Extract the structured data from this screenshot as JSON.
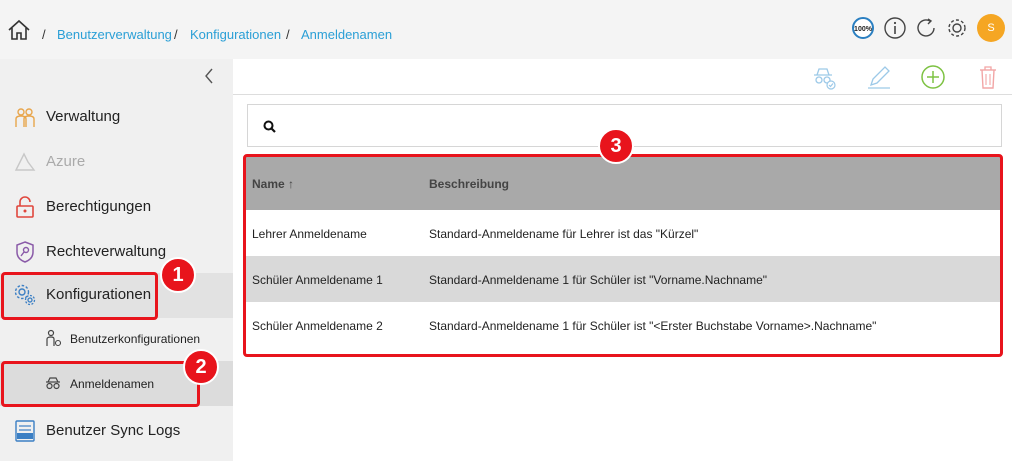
{
  "breadcrumb": {
    "separator": "/",
    "items": [
      "Benutzerverwaltung",
      "Konfigurationen",
      "Anmeldenamen"
    ]
  },
  "header": {
    "zoom_label": "100%",
    "avatar_initial": "S",
    "avatar_color": "#f5a623",
    "icons": [
      "zoom-icon",
      "info-icon",
      "refresh-icon",
      "settings-icon"
    ]
  },
  "sidebar": {
    "items": [
      {
        "label": "Verwaltung",
        "icon": "users-icon"
      },
      {
        "label": "Azure",
        "icon": "azure-icon"
      },
      {
        "label": "Berechtigungen",
        "icon": "lock-icon"
      },
      {
        "label": "Rechteverwaltung",
        "icon": "shield-key-icon"
      },
      {
        "label": "Konfigurationen",
        "icon": "gears-icon"
      },
      {
        "label": "Benutzer Sync Logs",
        "icon": "log-icon"
      }
    ],
    "sub_items": [
      {
        "label": "Benutzerkonfigurationen",
        "icon": "user-config-icon"
      },
      {
        "label": "Anmeldenamen",
        "icon": "glasses-icon"
      }
    ]
  },
  "toolbar": {
    "icons": [
      "incognito-check-icon",
      "edit-icon",
      "add-icon",
      "delete-icon"
    ]
  },
  "search": {
    "placeholder": "",
    "value": ""
  },
  "table": {
    "columns": [
      "Name ↑",
      "Beschreibung"
    ],
    "rows": [
      {
        "name": "Lehrer Anmeldename",
        "description": "Standard-Anmeldename für Lehrer ist das \"Kürzel\""
      },
      {
        "name": "Schüler Anmeldename 1",
        "description": "Standard-Anmeldename 1 für Schüler ist \"Vorname.Nachname\""
      },
      {
        "name": "Schüler Anmeldename 2",
        "description": "Standard-Anmeldename 1 für Schüler ist \"<Erster Buchstabe Vorname>.Nachname\""
      }
    ]
  },
  "callouts": [
    "1",
    "2",
    "3"
  ],
  "colors": {
    "accent_link": "#2a9fd6",
    "callout": "#e8141c",
    "add_green": "#7dc242",
    "delete_red": "#f2a5a5"
  }
}
